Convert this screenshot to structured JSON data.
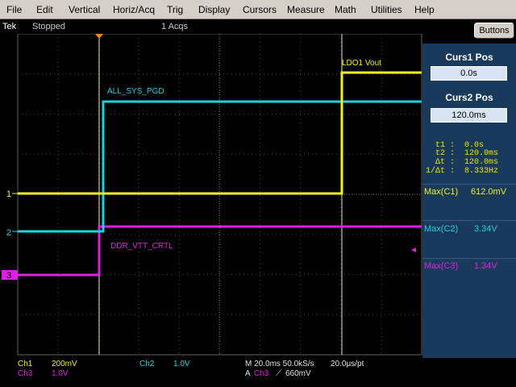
{
  "menu": [
    "File",
    "Edit",
    "Vertical",
    "Horiz/Acq",
    "Trig",
    "Display",
    "Cursors",
    "Measure",
    "Math",
    "Utilities",
    "Help"
  ],
  "status": {
    "brand": "Tek",
    "state": "Stopped",
    "acqs": "1 Acqs"
  },
  "buttons_label": "Buttons",
  "cursors": {
    "curs1_title": "Curs1 Pos",
    "curs1_value": "0.0s",
    "curs2_title": "Curs2 Pos",
    "curs2_value": "120.0ms",
    "readouts": [
      {
        "label": "t1 :",
        "value": "0.0s"
      },
      {
        "label": "t2 :",
        "value": "120.0ms"
      },
      {
        "label": "Δt :",
        "value": "120.0ms"
      },
      {
        "label": "1/Δt :",
        "value": "8.333Hz"
      }
    ]
  },
  "measurements": [
    {
      "label": "Max(C1)",
      "value": "612.0mV",
      "color": "#f0f020"
    },
    {
      "label": "Max(C2)",
      "value": "3.34V",
      "color": "#20d0e0"
    },
    {
      "label": "Max(C3)",
      "value": "1.34V",
      "color": "#e020e0"
    }
  ],
  "channels": {
    "ch1": {
      "name": "Ch1",
      "scale": "200mV",
      "color": "#f0f020",
      "marker": "1",
      "trace_label": "LDO1 Vout"
    },
    "ch2": {
      "name": "Ch2",
      "scale": "1.0V",
      "color": "#20d0e0",
      "marker": "2",
      "trace_label": "ALL_SYS_PGD"
    },
    "ch3": {
      "name": "Ch3",
      "scale": "1.0V",
      "color": "#e020e0",
      "marker": "3",
      "trace_label": "DDR_VTT_CRTL"
    }
  },
  "bottom": {
    "timebase": "M 20.0ms 50.0kS/s",
    "resolution": "20.0µs/pt",
    "trigger_prefix": "A",
    "trigger_ch": "Ch3",
    "trigger_slope": "⟋",
    "trigger_level": "660mV"
  }
}
